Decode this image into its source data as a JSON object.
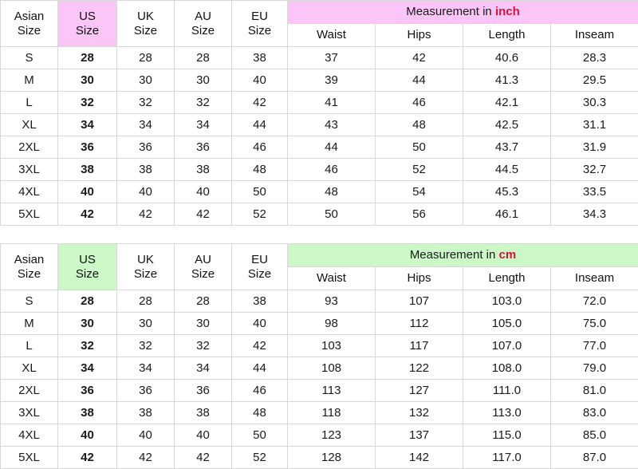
{
  "tables": [
    {
      "id": "inch-table",
      "accent_color": "#fbc6f7",
      "unit_text_color": "#d2143c",
      "size_headers": [
        {
          "line1": "Asian",
          "line2": "Size",
          "name": "asian-size"
        },
        {
          "line1": "US",
          "line2": "Size",
          "name": "us-size"
        },
        {
          "line1": "UK",
          "line2": "Size",
          "name": "uk-size"
        },
        {
          "line1": "AU",
          "line2": "Size",
          "name": "au-size"
        },
        {
          "line1": "EU",
          "line2": "Size",
          "name": "eu-size"
        }
      ],
      "measurement_title_prefix": "Measurement in ",
      "measurement_unit": "inch",
      "measurement_headers": [
        "Waist",
        "Hips",
        "Length",
        "Inseam"
      ],
      "rows": [
        {
          "asian": "S",
          "us": "28",
          "uk": "28",
          "au": "28",
          "eu": "38",
          "waist": "37",
          "hips": "42",
          "length": "40.6",
          "inseam": "28.3"
        },
        {
          "asian": "M",
          "us": "30",
          "uk": "30",
          "au": "30",
          "eu": "40",
          "waist": "39",
          "hips": "44",
          "length": "41.3",
          "inseam": "29.5"
        },
        {
          "asian": "L",
          "us": "32",
          "uk": "32",
          "au": "32",
          "eu": "42",
          "waist": "41",
          "hips": "46",
          "length": "42.1",
          "inseam": "30.3"
        },
        {
          "asian": "XL",
          "us": "34",
          "uk": "34",
          "au": "34",
          "eu": "44",
          "waist": "43",
          "hips": "48",
          "length": "42.5",
          "inseam": "31.1"
        },
        {
          "asian": "2XL",
          "us": "36",
          "uk": "36",
          "au": "36",
          "eu": "46",
          "waist": "44",
          "hips": "50",
          "length": "43.7",
          "inseam": "31.9"
        },
        {
          "asian": "3XL",
          "us": "38",
          "uk": "38",
          "au": "38",
          "eu": "48",
          "waist": "46",
          "hips": "52",
          "length": "44.5",
          "inseam": "32.7"
        },
        {
          "asian": "4XL",
          "us": "40",
          "uk": "40",
          "au": "40",
          "eu": "50",
          "waist": "48",
          "hips": "54",
          "length": "45.3",
          "inseam": "33.5"
        },
        {
          "asian": "5XL",
          "us": "42",
          "uk": "42",
          "au": "42",
          "eu": "52",
          "waist": "50",
          "hips": "56",
          "length": "46.1",
          "inseam": "34.3"
        }
      ]
    },
    {
      "id": "cm-table",
      "accent_color": "#ccf7c6",
      "unit_text_color": "#d2143c",
      "size_headers": [
        {
          "line1": "Asian",
          "line2": "Size",
          "name": "asian-size"
        },
        {
          "line1": "US",
          "line2": "Size",
          "name": "us-size"
        },
        {
          "line1": "UK",
          "line2": "Size",
          "name": "uk-size"
        },
        {
          "line1": "AU",
          "line2": "Size",
          "name": "au-size"
        },
        {
          "line1": "EU",
          "line2": "Size",
          "name": "eu-size"
        }
      ],
      "measurement_title_prefix": "Measurement in ",
      "measurement_unit": "cm",
      "measurement_headers": [
        "Waist",
        "Hips",
        "Length",
        "Inseam"
      ],
      "rows": [
        {
          "asian": "S",
          "us": "28",
          "uk": "28",
          "au": "28",
          "eu": "38",
          "waist": "93",
          "hips": "107",
          "length": "103.0",
          "inseam": "72.0"
        },
        {
          "asian": "M",
          "us": "30",
          "uk": "30",
          "au": "30",
          "eu": "40",
          "waist": "98",
          "hips": "112",
          "length": "105.0",
          "inseam": "75.0"
        },
        {
          "asian": "L",
          "us": "32",
          "uk": "32",
          "au": "32",
          "eu": "42",
          "waist": "103",
          "hips": "117",
          "length": "107.0",
          "inseam": "77.0"
        },
        {
          "asian": "XL",
          "us": "34",
          "uk": "34",
          "au": "34",
          "eu": "44",
          "waist": "108",
          "hips": "122",
          "length": "108.0",
          "inseam": "79.0"
        },
        {
          "asian": "2XL",
          "us": "36",
          "uk": "36",
          "au": "36",
          "eu": "46",
          "waist": "113",
          "hips": "127",
          "length": "111.0",
          "inseam": "81.0"
        },
        {
          "asian": "3XL",
          "us": "38",
          "uk": "38",
          "au": "38",
          "eu": "48",
          "waist": "118",
          "hips": "132",
          "length": "113.0",
          "inseam": "83.0"
        },
        {
          "asian": "4XL",
          "us": "40",
          "uk": "40",
          "au": "40",
          "eu": "50",
          "waist": "123",
          "hips": "137",
          "length": "115.0",
          "inseam": "85.0"
        },
        {
          "asian": "5XL",
          "us": "42",
          "uk": "42",
          "au": "42",
          "eu": "52",
          "waist": "128",
          "hips": "142",
          "length": "117.0",
          "inseam": "87.0"
        }
      ]
    }
  ]
}
